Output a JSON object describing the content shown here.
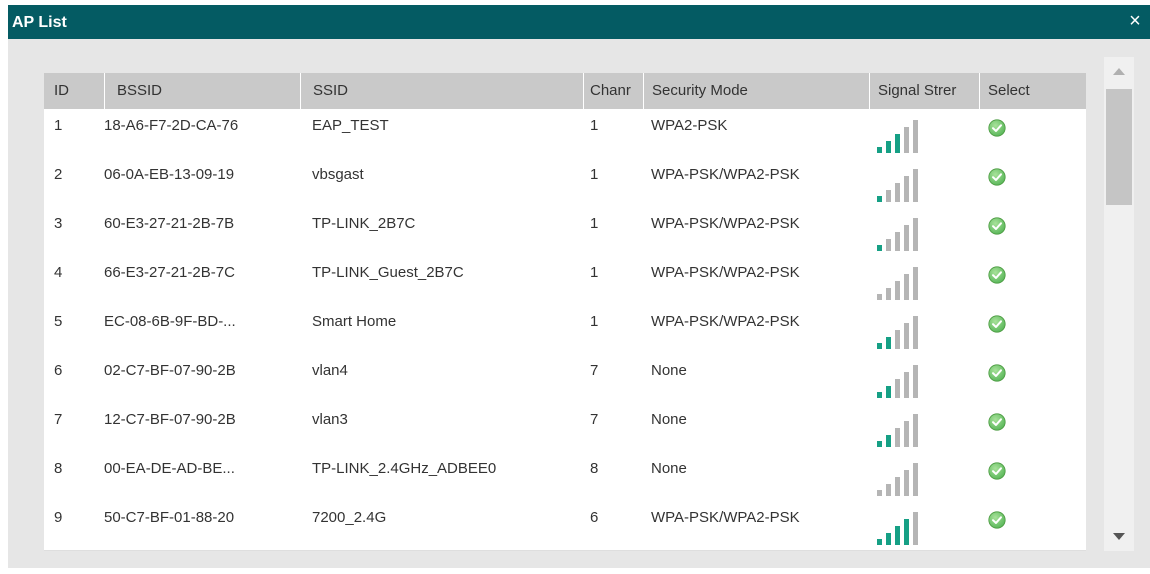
{
  "window": {
    "title": "AP List",
    "close_glyph": "×"
  },
  "table": {
    "headers": [
      "ID",
      "BSSID",
      "SSID",
      "Chanr",
      "Security Mode",
      "Signal Strer",
      "Select"
    ],
    "rows": [
      {
        "id": "1",
        "bssid": "18-A6-F7-2D-CA-76",
        "ssid": "EAP_TEST",
        "channel": "1",
        "security": "WPA2-PSK",
        "signal_bars": 3,
        "select_icon": "check-circle-icon"
      },
      {
        "id": "2",
        "bssid": "06-0A-EB-13-09-19",
        "ssid": "vbsgast",
        "channel": "1",
        "security": "WPA-PSK/WPA2-PSK",
        "signal_bars": 1,
        "select_icon": "check-circle-icon"
      },
      {
        "id": "3",
        "bssid": "60-E3-27-21-2B-7B",
        "ssid": "TP-LINK_2B7C",
        "channel": "1",
        "security": "WPA-PSK/WPA2-PSK",
        "signal_bars": 1,
        "select_icon": "check-circle-icon"
      },
      {
        "id": "4",
        "bssid": "66-E3-27-21-2B-7C",
        "ssid": "TP-LINK_Guest_2B7C",
        "channel": "1",
        "security": "WPA-PSK/WPA2-PSK",
        "signal_bars": 0,
        "select_icon": "check-circle-icon"
      },
      {
        "id": "5",
        "bssid": "EC-08-6B-9F-BD-...",
        "ssid": "Smart Home",
        "channel": "1",
        "security": "WPA-PSK/WPA2-PSK",
        "signal_bars": 2,
        "select_icon": "check-circle-icon"
      },
      {
        "id": "6",
        "bssid": "02-C7-BF-07-90-2B",
        "ssid": "vlan4",
        "channel": "7",
        "security": "None",
        "signal_bars": 2,
        "select_icon": "check-circle-icon"
      },
      {
        "id": "7",
        "bssid": "12-C7-BF-07-90-2B",
        "ssid": "vlan3",
        "channel": "7",
        "security": "None",
        "signal_bars": 2,
        "select_icon": "check-circle-icon"
      },
      {
        "id": "8",
        "bssid": "00-EA-DE-AD-BE...",
        "ssid": "TP-LINK_2.4GHz_ADBEE0",
        "channel": "8",
        "security": "None",
        "signal_bars": 0,
        "select_icon": "check-circle-icon"
      },
      {
        "id": "9",
        "bssid": "50-C7-BF-01-88-20",
        "ssid": "7200_2.4G",
        "channel": "6",
        "security": "WPA-PSK/WPA2-PSK",
        "signal_bars": 4,
        "select_icon": "check-circle-icon"
      }
    ]
  },
  "colors": {
    "titlebar": "#045b63",
    "signal_active": "#16a085",
    "signal_inactive": "#b5b5b5",
    "select_green": "#5cb85c"
  },
  "icons": {
    "close": "close-icon",
    "scroll_up": "chevron-up-icon",
    "scroll_down": "chevron-down-icon"
  }
}
